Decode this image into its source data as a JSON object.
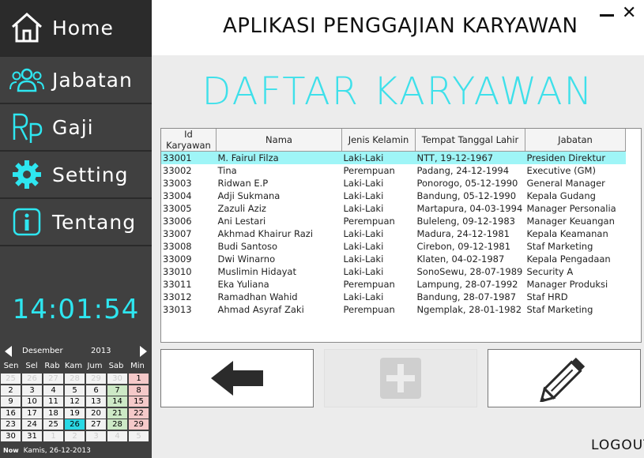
{
  "app_title": "APLIKASI PENGGAJIAN KARYAWAN",
  "page_title": "DAFTAR KARYAWAN",
  "sidebar": {
    "items": [
      {
        "label": "Home",
        "icon": "home-icon"
      },
      {
        "label": "Jabatan",
        "icon": "users-icon"
      },
      {
        "label": "Gaji",
        "icon": "rupiah-icon"
      },
      {
        "label": "Setting",
        "icon": "gear-icon"
      },
      {
        "label": "Tentang",
        "icon": "info-icon"
      }
    ],
    "accent": "#2ee6f0"
  },
  "clock": "14:01:54",
  "calendar": {
    "month": "Desember",
    "year": "2013",
    "days": [
      "Sen",
      "Sel",
      "Rab",
      "Kam",
      "Jum",
      "Sab",
      "Min"
    ],
    "weeks": [
      [
        "25",
        "26",
        "27",
        "28",
        "29",
        "30",
        "1"
      ],
      [
        "2",
        "3",
        "4",
        "5",
        "6",
        "7",
        "8"
      ],
      [
        "9",
        "10",
        "11",
        "12",
        "13",
        "14",
        "15"
      ],
      [
        "16",
        "17",
        "18",
        "19",
        "20",
        "21",
        "22"
      ],
      [
        "23",
        "24",
        "25",
        "26",
        "27",
        "28",
        "29"
      ],
      [
        "30",
        "31",
        "1",
        "2",
        "3",
        "4",
        "5"
      ]
    ],
    "now_label": "Now",
    "now_date": "Kamis, 26-12-2013"
  },
  "table": {
    "columns": [
      "Id Karyawan",
      "Nama",
      "Jenis Kelamin",
      "Tempat Tanggal Lahir",
      "Jabatan"
    ],
    "rows": [
      [
        "33001",
        "M. Fairul Filza",
        "Laki-Laki",
        "NTT, 19-12-1967",
        "Presiden Direktur"
      ],
      [
        "33002",
        "Tina",
        "Perempuan",
        "Padang, 24-12-1994",
        "Executive (GM)"
      ],
      [
        "33003",
        "Ridwan E.P",
        "Laki-Laki",
        "Ponorogo, 05-12-1990",
        "General Manager"
      ],
      [
        "33004",
        "Adji Sukmana",
        "Laki-Laki",
        "Bandung, 05-12-1990",
        "Kepala Gudang"
      ],
      [
        "33005",
        "Zazuli Aziz",
        "Laki-Laki",
        "Martapura, 04-03-1994",
        "Manager Personalia"
      ],
      [
        "33006",
        "Ani Lestari",
        "Perempuan",
        "Buleleng, 09-12-1983",
        "Manager Keuangan"
      ],
      [
        "33007",
        "Akhmad Khairur Razi",
        "Laki-Laki",
        "Madura, 24-12-1981",
        "Kepala Keamanan"
      ],
      [
        "33008",
        "Budi Santoso",
        "Laki-Laki",
        "Cirebon, 09-12-1981",
        "Staf Marketing"
      ],
      [
        "33009",
        "Dwi Winarno",
        "Laki-Laki",
        "Klaten, 04-02-1987",
        "Kepala Pengadaan"
      ],
      [
        "33010",
        "Muslimin Hidayat",
        "Laki-Laki",
        "SonoSewu, 28-07-1989",
        "Security A"
      ],
      [
        "33011",
        "Eka Yuliana",
        "Perempuan",
        "Lampung, 28-07-1992",
        "Manager Produksi"
      ],
      [
        "33012",
        "Ramadhan Wahid",
        "Laki-Laki",
        "Bandung, 28-07-1987",
        "Staf HRD"
      ],
      [
        "33013",
        "Ahmad Asyraf Zaki",
        "Perempuan",
        "Ngemplak, 28-01-1982",
        "Staf Marketing"
      ]
    ],
    "selected_row": 0
  },
  "buttons": {
    "back": "arrow-left-icon",
    "add": "plus-icon",
    "edit": "pencil-icon"
  },
  "logout": "LOGOUT"
}
